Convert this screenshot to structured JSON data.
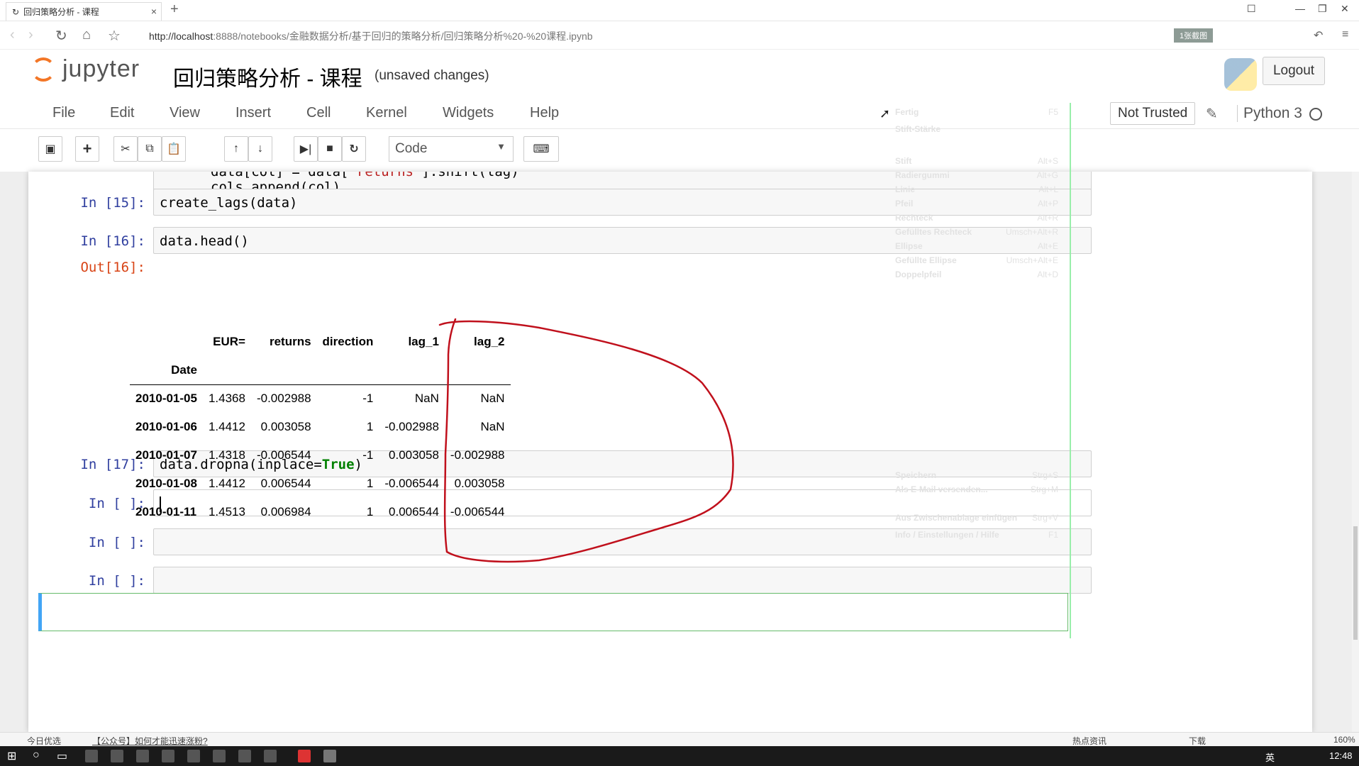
{
  "browser": {
    "tab_title": "回归策略分析 - 课程",
    "url_host": "http://localhost",
    "url_rest": ":8888/notebooks/金融数据分析/基于回归的策略分析/回归策略分析%20-%20课程.ipynb",
    "badge": "1张截图"
  },
  "header": {
    "logo_text": "jupyter",
    "notebook_title": "回归策略分析 - 课程",
    "save_status": "(unsaved changes)",
    "logout": "Logout"
  },
  "menubar": {
    "items": [
      "File",
      "Edit",
      "View",
      "Insert",
      "Cell",
      "Kernel",
      "Widgets",
      "Help"
    ],
    "trust": "Not Trusted",
    "kernel_name": "Python 3"
  },
  "toolbar": {
    "cell_type": "Code"
  },
  "cells": [
    {
      "prompt": "",
      "code_line1": "data[col] = data[",
      "code_str": "'returns'",
      "code_line1_rest": "].shift(lag)",
      "code_line2": "cols.append(col)"
    },
    {
      "prompt": "In  [15]:",
      "code": "create_lags(data)"
    },
    {
      "prompt": "In  [16]:",
      "code": "data.head()",
      "out_prompt": "Out[16]:"
    },
    {
      "prompt": "In  [17]:",
      "code_a": "data.dropna(inplace=",
      "code_kw": "True",
      "code_b": ")"
    },
    {
      "prompt": "In  [ ]:",
      "code": ""
    },
    {
      "prompt": "In  [ ]:",
      "code": ""
    },
    {
      "prompt": "In  [ ]:",
      "code": ""
    }
  ],
  "dataframe": {
    "columns": [
      "EUR=",
      "returns",
      "direction",
      "lag_1",
      "lag_2"
    ],
    "index_name": "Date",
    "rows": [
      {
        "date": "2010-01-05",
        "values": [
          "1.4368",
          "-0.002988",
          "-1",
          "NaN",
          "NaN"
        ]
      },
      {
        "date": "2010-01-06",
        "values": [
          "1.4412",
          "0.003058",
          "1",
          "-0.002988",
          "NaN"
        ]
      },
      {
        "date": "2010-01-07",
        "values": [
          "1.4318",
          "-0.006544",
          "-1",
          "0.003058",
          "-0.002988"
        ]
      },
      {
        "date": "2010-01-08",
        "values": [
          "1.4412",
          "0.006544",
          "1",
          "-0.006544",
          "0.003058"
        ]
      },
      {
        "date": "2010-01-11",
        "values": [
          "1.4513",
          "0.006984",
          "1",
          "0.006544",
          "-0.006544"
        ]
      }
    ]
  },
  "ghost_menu": [
    {
      "label": "Fertig",
      "key": "F5"
    },
    {
      "label": "Stift-Stärke",
      "key": ""
    },
    {
      "label": "Stift",
      "key": "Alt+S"
    },
    {
      "label": "Radiergummi",
      "key": "Alt+G"
    },
    {
      "label": "Linie",
      "key": "Alt+L"
    },
    {
      "label": "Pfeil",
      "key": "Alt+P"
    },
    {
      "label": "Rechteck",
      "key": "Alt+R"
    },
    {
      "label": "Gefülltes Rechteck",
      "key": "Umsch+Alt+R"
    },
    {
      "label": "Ellipse",
      "key": "Alt+E"
    },
    {
      "label": "Gefüllte Ellipse",
      "key": "Umsch+Alt+E"
    },
    {
      "label": "Doppelpfeil",
      "key": "Alt+D"
    },
    {
      "label": "Speichern",
      "key": "Strg+S"
    },
    {
      "label": "Als E-Mail versenden...",
      "key": "Strg+M"
    },
    {
      "label": "Aus Zwischenablage einfügen",
      "key": "Strg+V"
    },
    {
      "label": "Info / Einstellungen / Hilfe",
      "key": "F1"
    }
  ],
  "statusbar": {
    "left_text": "今日优选",
    "link_text": "【公众号】如何才能迅速涨粉?",
    "news": "热点资讯",
    "download": "下载",
    "zoom": "160%"
  },
  "taskbar": {
    "ime": "英",
    "time": "12:48"
  }
}
